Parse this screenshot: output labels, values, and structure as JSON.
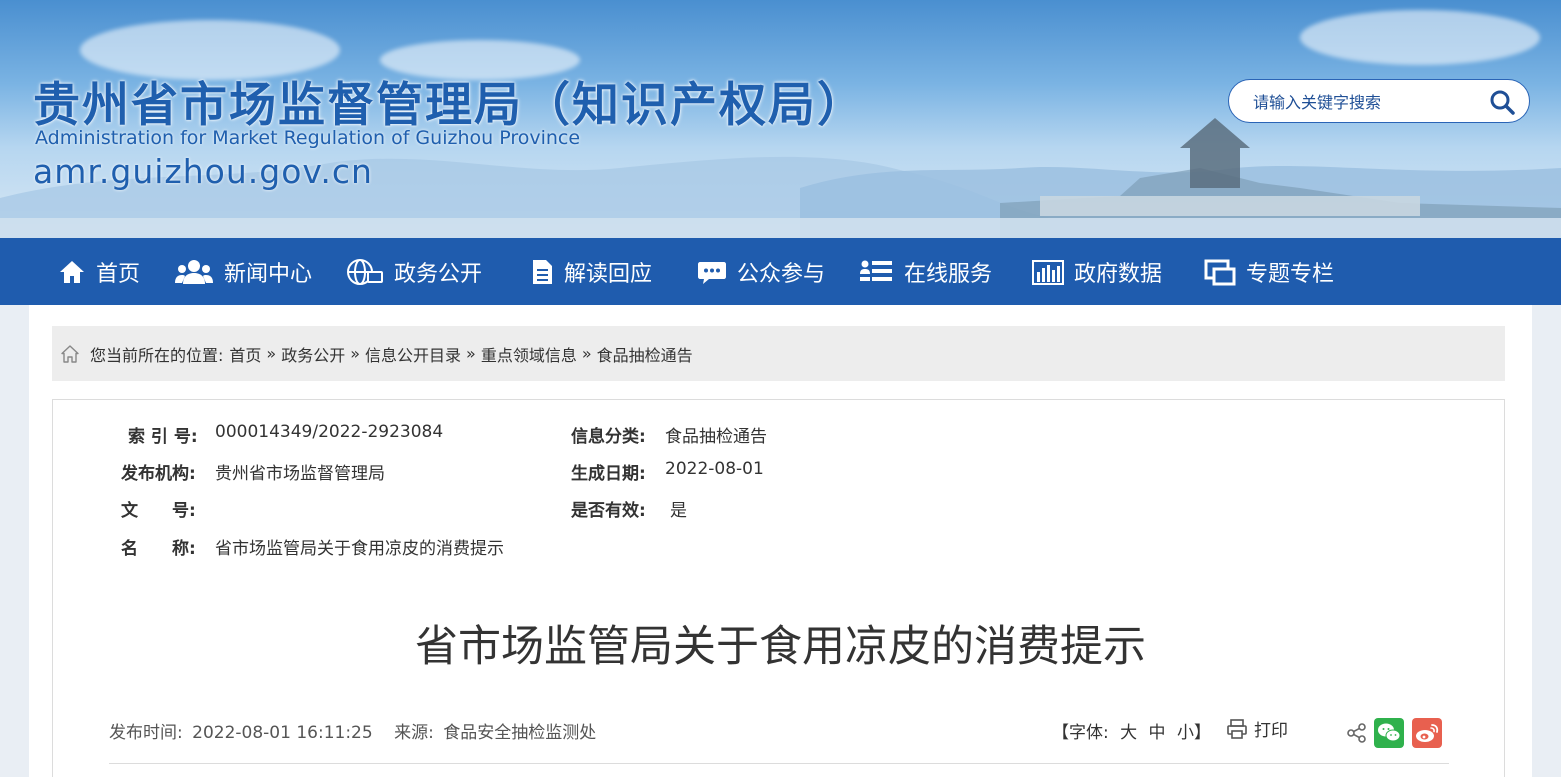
{
  "header": {
    "title": "贵州省市场监督管理局（知识产权局）",
    "subtitle": "Administration for Market Regulation of Guizhou Province",
    "domain": "amr.guizhou.gov.cn",
    "search_placeholder": "请输入关键字搜索"
  },
  "nav": {
    "items": [
      {
        "label": "首页",
        "icon": "home-icon"
      },
      {
        "label": "新闻中心",
        "icon": "people-icon"
      },
      {
        "label": "政务公开",
        "icon": "globe-icon"
      },
      {
        "label": "解读回应",
        "icon": "document-icon"
      },
      {
        "label": "公众参与",
        "icon": "chat-icon"
      },
      {
        "label": "在线服务",
        "icon": "list-icon"
      },
      {
        "label": "政府数据",
        "icon": "bar-chart-icon"
      },
      {
        "label": "专题专栏",
        "icon": "windows-icon"
      }
    ]
  },
  "breadcrumb": {
    "prefix": "您当前所在的位置:",
    "items": [
      "首页",
      "政务公开",
      "信息公开目录",
      "重点领域信息",
      "食品抽检通告"
    ],
    "separator": "»"
  },
  "meta": {
    "index_label": "索 引 号:",
    "index_value": "000014349/2022-2923084",
    "category_label": "信息分类:",
    "category_value": "食品抽检通告",
    "publisher_label": "发布机构:",
    "publisher_value": "贵州省市场监督管理局",
    "date_label": "生成日期:",
    "date_value": "2022-08-01",
    "doc_no_label": "文　　号:",
    "doc_no_value": "",
    "valid_label": "是否有效:",
    "valid_value": "是",
    "name_label": "名　　称:",
    "name_value": "省市场监管局关于食用凉皮的消费提示"
  },
  "article": {
    "title": "省市场监管局关于食用凉皮的消费提示",
    "publish_time_label": "发布时间:",
    "publish_time": "2022-08-01 16:11:25",
    "source_label": "来源:",
    "source": "食品安全抽检监测处",
    "font_label": "【字体:",
    "font_large": "大",
    "font_medium": "中",
    "font_small": "小】",
    "print_label": "打印"
  },
  "colors": {
    "brand_blue": "#1f5cae",
    "wechat_green": "#2fb14c",
    "weibo_red": "#e8604f"
  }
}
